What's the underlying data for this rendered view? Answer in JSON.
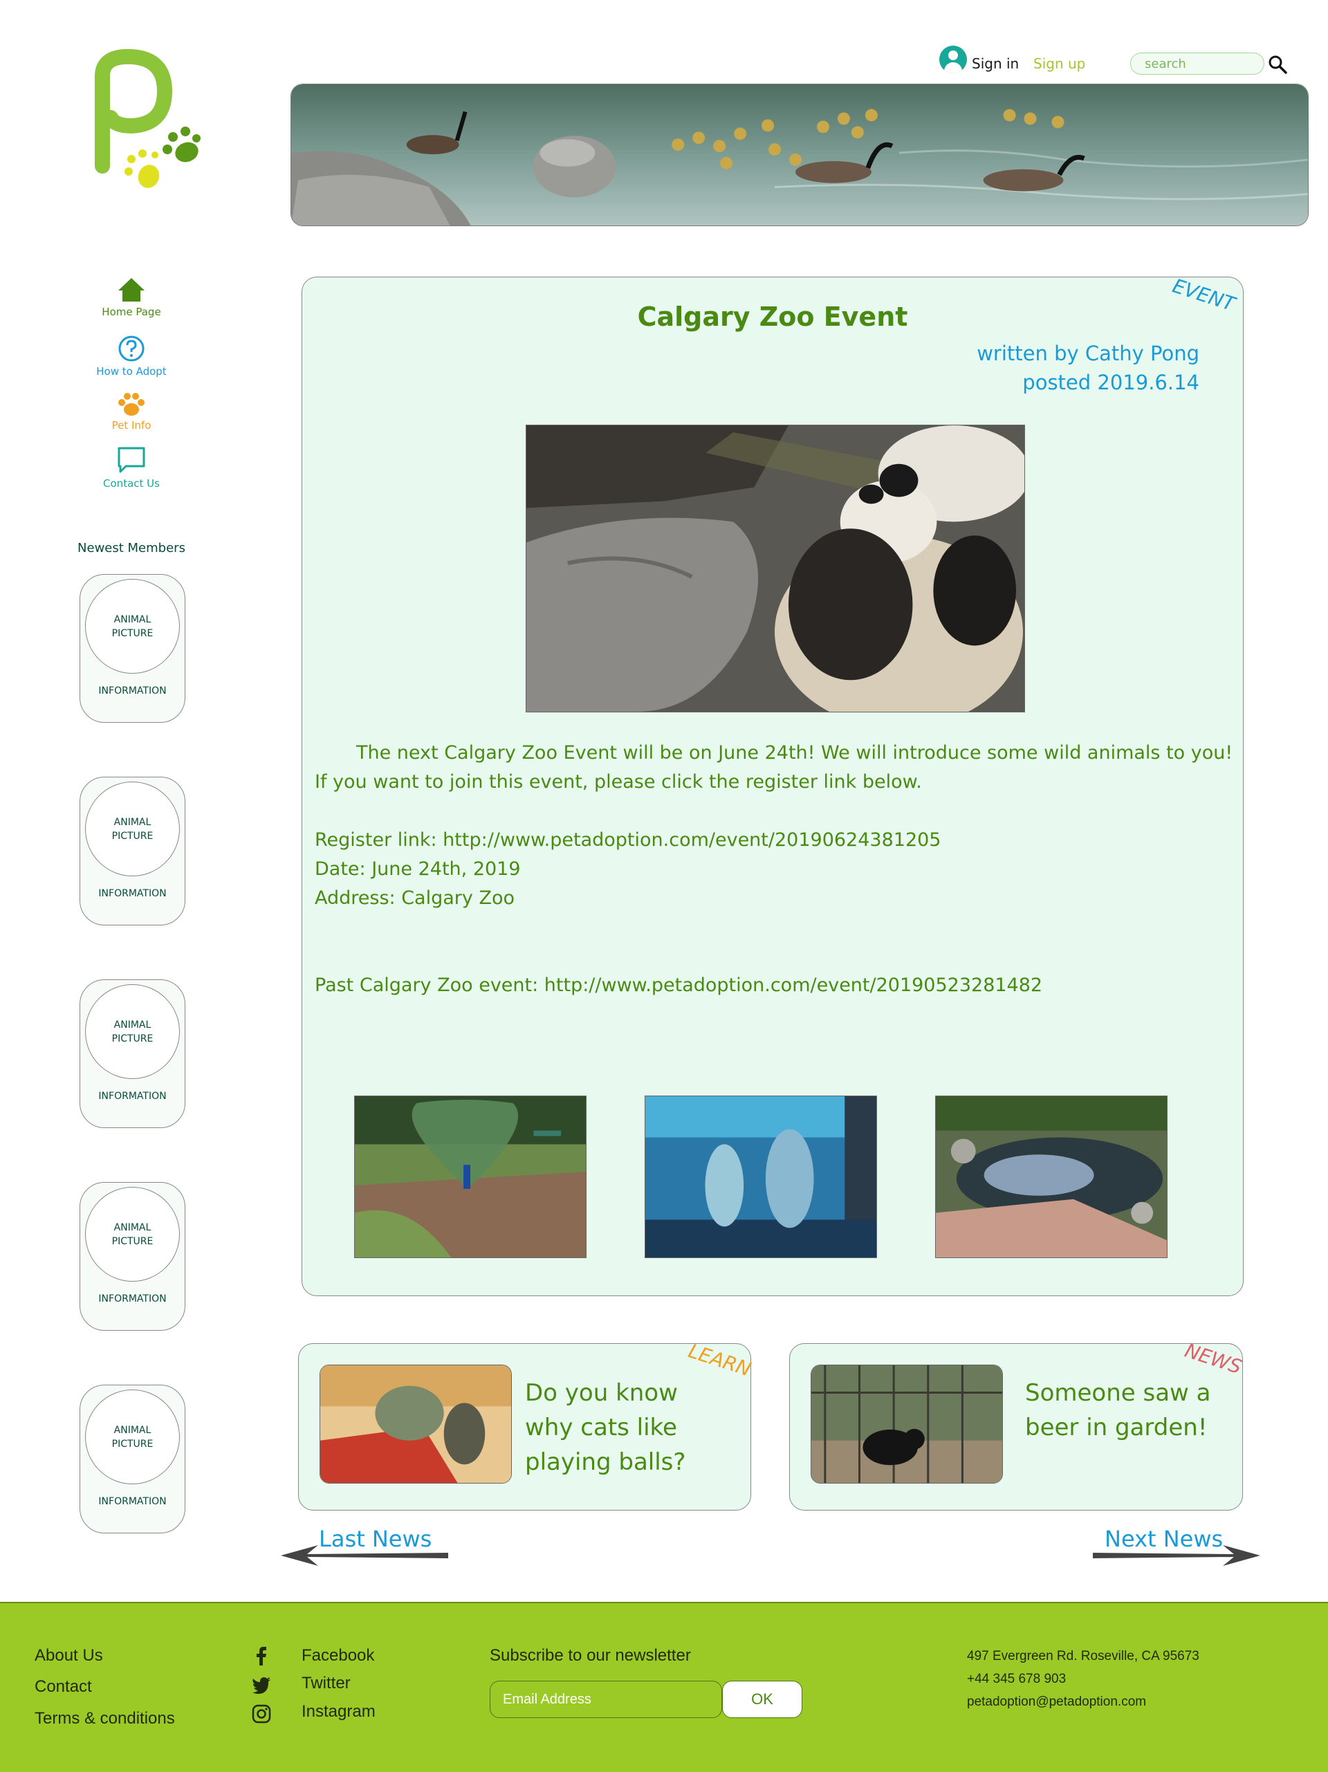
{
  "header": {
    "sign_in": "Sign in",
    "sign_up": "Sign up",
    "search_placeholder": "search"
  },
  "sidebar": {
    "nav": [
      {
        "label": "Home Page",
        "icon": "home-icon",
        "color": "#4a8a12"
      },
      {
        "label": "How to Adopt",
        "icon": "question-icon",
        "color": "#1a9ad6"
      },
      {
        "label": "Pet Info",
        "icon": "paw-icon",
        "color": "#f0a020"
      },
      {
        "label": "Contact Us",
        "icon": "chat-icon",
        "color": "#17a89a"
      }
    ],
    "newest_title": "Newest Members",
    "members": [
      {
        "picture": "ANIMAL PICTURE",
        "info": "INFORMATION"
      },
      {
        "picture": "ANIMAL PICTURE",
        "info": "INFORMATION"
      },
      {
        "picture": "ANIMAL PICTURE",
        "info": "INFORMATION"
      },
      {
        "picture": "ANIMAL PICTURE",
        "info": "INFORMATION"
      },
      {
        "picture": "ANIMAL PICTURE",
        "info": "INFORMATION"
      }
    ]
  },
  "article": {
    "tag": "EVENT",
    "title": "Calgary Zoo Event",
    "author": "written by Cathy Pong",
    "posted": "posted 2019.6.14",
    "intro_line1": "The next Calgary Zoo Event will be on June 24th! We will introduce some wild animals to you!",
    "intro_line2": "If you want to join this event, please click the register link below.",
    "register": "Register link: http://www.petadoption.com/event/20190624381205",
    "date": "Date: June 24th, 2019",
    "address": "Address: Calgary Zoo",
    "past": "Past Calgary Zoo event: http://www.petadoption.com/event/20190523281482",
    "photos": [
      "peacock-photo",
      "penguins-photo",
      "duck-pond-photo"
    ]
  },
  "cards": [
    {
      "tag": "LEARN",
      "text": "Do you know why cats like playing balls?",
      "tag_color": "#f0a020"
    },
    {
      "tag": "NEWS",
      "text": "Someone saw a beer in garden!",
      "tag_color": "#e0606a"
    }
  ],
  "pager": {
    "last": "Last News",
    "next": "Next News"
  },
  "footer": {
    "links": [
      "About Us",
      "Contact",
      "Terms & conditions"
    ],
    "social": [
      {
        "label": "Facebook",
        "icon": "facebook-icon"
      },
      {
        "label": "Twitter",
        "icon": "twitter-icon"
      },
      {
        "label": "Instagram",
        "icon": "instagram-icon"
      }
    ],
    "newsletter_title": "Subscribe to our newsletter",
    "email_placeholder": "Email Address",
    "ok": "OK",
    "address": "497 Evergreen Rd. Roseville, CA 95673",
    "phone": "+44 345 678 903",
    "email": "petadoption@petadoption.com"
  },
  "colors": {
    "brand_green": "#9bc925",
    "text_green": "#4a8a12",
    "accent_blue": "#1a9ad6",
    "panel_bg": "#e8f9ef"
  }
}
